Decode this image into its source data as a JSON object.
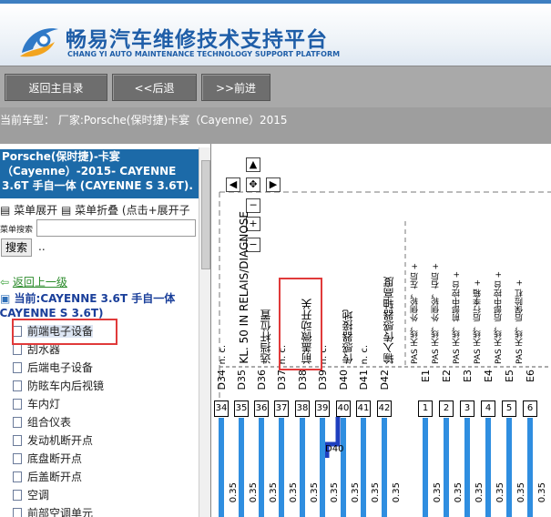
{
  "header": {
    "title": "畅易汽车维修技术支持平台",
    "subtitle": "CHANG YI AUTO MAINTENANCE TECHNOLOGY SUPPORT PLATFORM"
  },
  "nav": {
    "home_label": "返回主目录",
    "back_label": "<<后退",
    "forward_label": ">>前进"
  },
  "vehicle_line": "当前车型：  厂家:Porsche(保时捷)卡宴（Cayenne）2015",
  "sidebar": {
    "head_line1": "Porsche(保时捷)-卡宴",
    "head_line2": "（Cayenne）-2015- CAYENNE",
    "head_line3": "3.6T 手自一体 (CAYENNE S 3.6T).",
    "menu_line": "▤  菜单展开 ▤  菜单折叠 (点击+展开子",
    "search_label": "菜单搜索",
    "search_value": "",
    "search_button": "搜索",
    "search_dots": "..",
    "up_link": "返回上一级",
    "current_line1": "当前:CAYENNE 3.6T 手自一体",
    "current_line2": "(CAYENNE S 3.6T)",
    "items": [
      "前端电子设备",
      "刮水器",
      "后端电子设备",
      "防眩车内后视镜",
      "车内灯",
      "组合仪表",
      "发动机断开点",
      "底盘断开点",
      "后盖断开点",
      "空调",
      "前部空调单元"
    ]
  },
  "diagram": {
    "pin_codes": [
      "D34",
      "D35",
      "D36",
      "D37",
      "D38",
      "D39",
      "D40",
      "D41",
      "D42",
      "E1",
      "E2",
      "E3",
      "E4",
      "E5",
      "E6"
    ],
    "pin_numbers": [
      "34",
      "35",
      "36",
      "37",
      "38",
      "39",
      "40",
      "41",
      "42",
      "1",
      "2",
      "3",
      "4",
      "5",
      "6"
    ],
    "labels": [
      "n. c.",
      "KL. 50 IN RELAIS/DIAGNOSE",
      "选挡杆位置",
      "n. c.",
      "前盖微动开关",
      "n. c.",
      "传感器接地",
      "n. c.",
      "输入传感器轴高度"
    ],
    "e_labels": [
      "PAS 天线，外侧轮，左后 +",
      "PAS 天线，外侧轮，右后 +",
      "PAS 天线，前部中控台 +",
      "PAS 天线，后行李箱 +",
      "PAS 天线，后部中控台 +",
      "PAS 天线，后保险杠 +"
    ],
    "wire_label": "0.35",
    "connector_tag": "D40",
    "controls": [
      "▲",
      "◀",
      "✥",
      "▶",
      "─",
      "+",
      "−"
    ]
  }
}
